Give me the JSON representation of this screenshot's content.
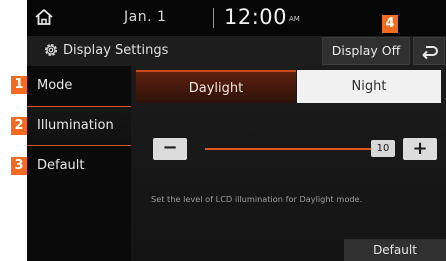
{
  "status": {
    "home_icon": "home-icon",
    "date": "Jan.  1",
    "time": "12:00",
    "ampm": "AM"
  },
  "header": {
    "settings_icon": "gear-icon",
    "title": "Display Settings",
    "display_off_label": "Display Off",
    "back_icon": "back-arrow-icon"
  },
  "menu": {
    "items": [
      {
        "label": "Mode",
        "selected": false
      },
      {
        "label": "Illumination",
        "selected": true
      },
      {
        "label": "Default",
        "selected": false
      }
    ]
  },
  "tabs": [
    {
      "label": "Daylight",
      "active": true
    },
    {
      "label": "Night",
      "active": false
    }
  ],
  "slider": {
    "minus_label": "−",
    "plus_label": "+",
    "value": "10",
    "max": 10,
    "fill_fraction": 1.0
  },
  "description": "Set the level of LCD illumination for Daylight mode.",
  "default_button_label": "Default",
  "callouts": [
    "1",
    "2",
    "3",
    "4"
  ],
  "colors": {
    "accent": "#e0561f",
    "callout": "#f36b21",
    "background": "#0c0c0c"
  }
}
